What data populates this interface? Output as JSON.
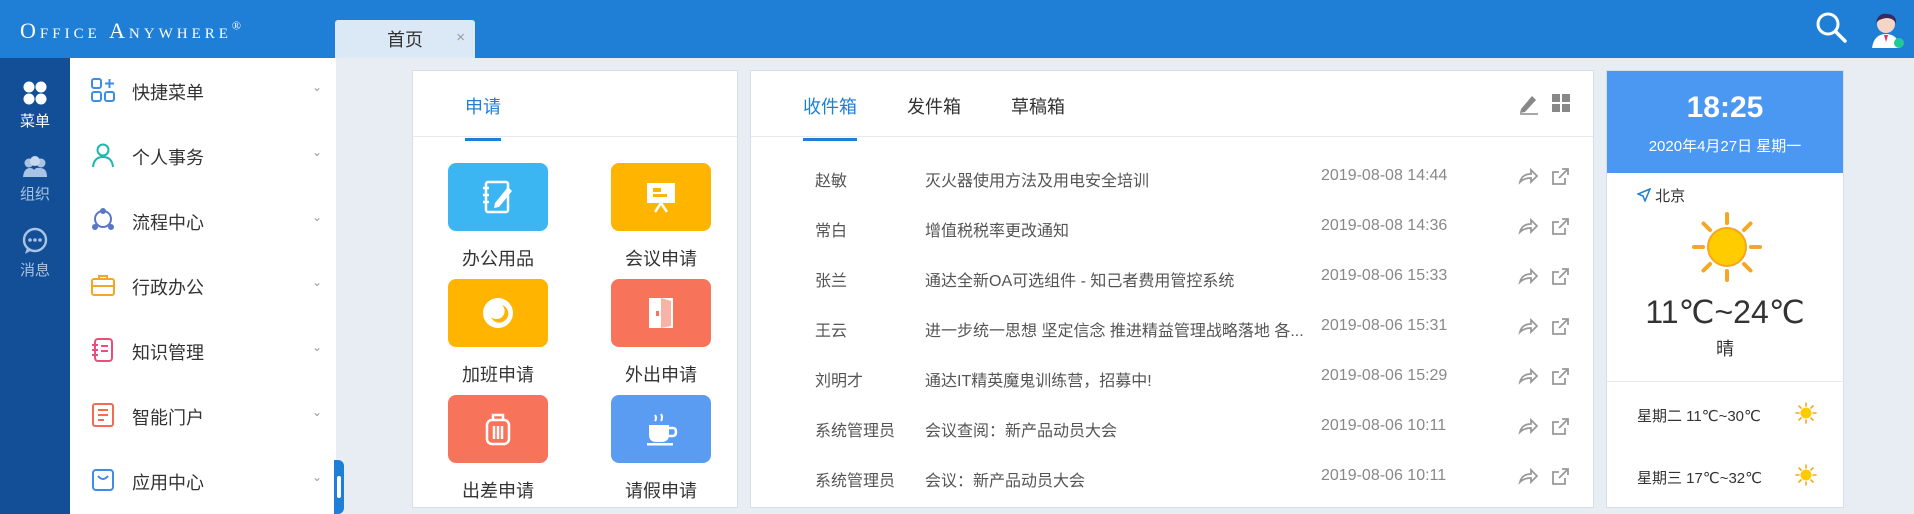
{
  "header": {
    "logo": "Office Anywhere",
    "logo_mark": "®",
    "tab_home": "首页",
    "tab_close": "×"
  },
  "leftnav": [
    {
      "label": "菜单",
      "icon": "grid-icon",
      "active": true
    },
    {
      "label": "组织",
      "icon": "people-icon",
      "active": false
    },
    {
      "label": "消息",
      "icon": "chat-icon",
      "active": false
    }
  ],
  "menu": [
    {
      "label": "快捷菜单",
      "icon": "quick-menu-icon"
    },
    {
      "label": "个人事务",
      "icon": "user-icon"
    },
    {
      "label": "流程中心",
      "icon": "workflow-icon"
    },
    {
      "label": "行政办公",
      "icon": "briefcase-icon"
    },
    {
      "label": "知识管理",
      "icon": "notebook-icon"
    },
    {
      "label": "智能门户",
      "icon": "portal-icon"
    },
    {
      "label": "应用中心",
      "icon": "app-center-icon"
    }
  ],
  "apply": {
    "tab": "申请",
    "tiles": [
      {
        "label": "办公用品",
        "icon": "notebook-pen-icon",
        "color": "#3cb6f2"
      },
      {
        "label": "会议申请",
        "icon": "presentation-icon",
        "color": "#ffb400"
      },
      {
        "label": "加班申请",
        "icon": "moon-icon",
        "color": "#ffb400"
      },
      {
        "label": "外出申请",
        "icon": "door-icon",
        "color": "#f7735a"
      },
      {
        "label": "出差申请",
        "icon": "luggage-icon",
        "color": "#f7735a"
      },
      {
        "label": "请假申请",
        "icon": "coffee-cup-icon",
        "color": "#5b9cf3"
      }
    ]
  },
  "mail": {
    "tabs": [
      "收件箱",
      "发件箱",
      "草稿箱"
    ],
    "rows": [
      {
        "sender": "赵敏",
        "subject": "灭火器使用方法及用电安全培训",
        "time": "2019-08-08 14:44"
      },
      {
        "sender": "常白",
        "subject": "增值税税率更改通知",
        "time": "2019-08-08 14:36"
      },
      {
        "sender": "张兰",
        "subject": "通达全新OA可选组件 - 知己者费用管控系统",
        "time": "2019-08-06 15:33"
      },
      {
        "sender": "王云",
        "subject": "进一步统一思想 坚定信念 推进精益管理战略落地 各...",
        "time": "2019-08-06 15:31"
      },
      {
        "sender": "刘明才",
        "subject": "通达IT精英魔鬼训练营，招募中!",
        "time": "2019-08-06 15:29"
      },
      {
        "sender": "系统管理员",
        "subject": "会议查阅：新产品动员大会",
        "time": "2019-08-06 10:11"
      },
      {
        "sender": "系统管理员",
        "subject": "会议：新产品动员大会",
        "time": "2019-08-06 10:11"
      }
    ]
  },
  "weather": {
    "time": "18:25",
    "date": "2020年4月27日 星期一",
    "location": "北京",
    "temp": "11℃~24℃",
    "desc": "晴",
    "forecast": [
      {
        "text": "星期二 11℃~30℃"
      },
      {
        "text": "星期三 17℃~32℃"
      }
    ]
  },
  "colors": {
    "brand": "#1f7fd6",
    "leftnav": "#124f97",
    "weather_head": "#4a98f2"
  }
}
